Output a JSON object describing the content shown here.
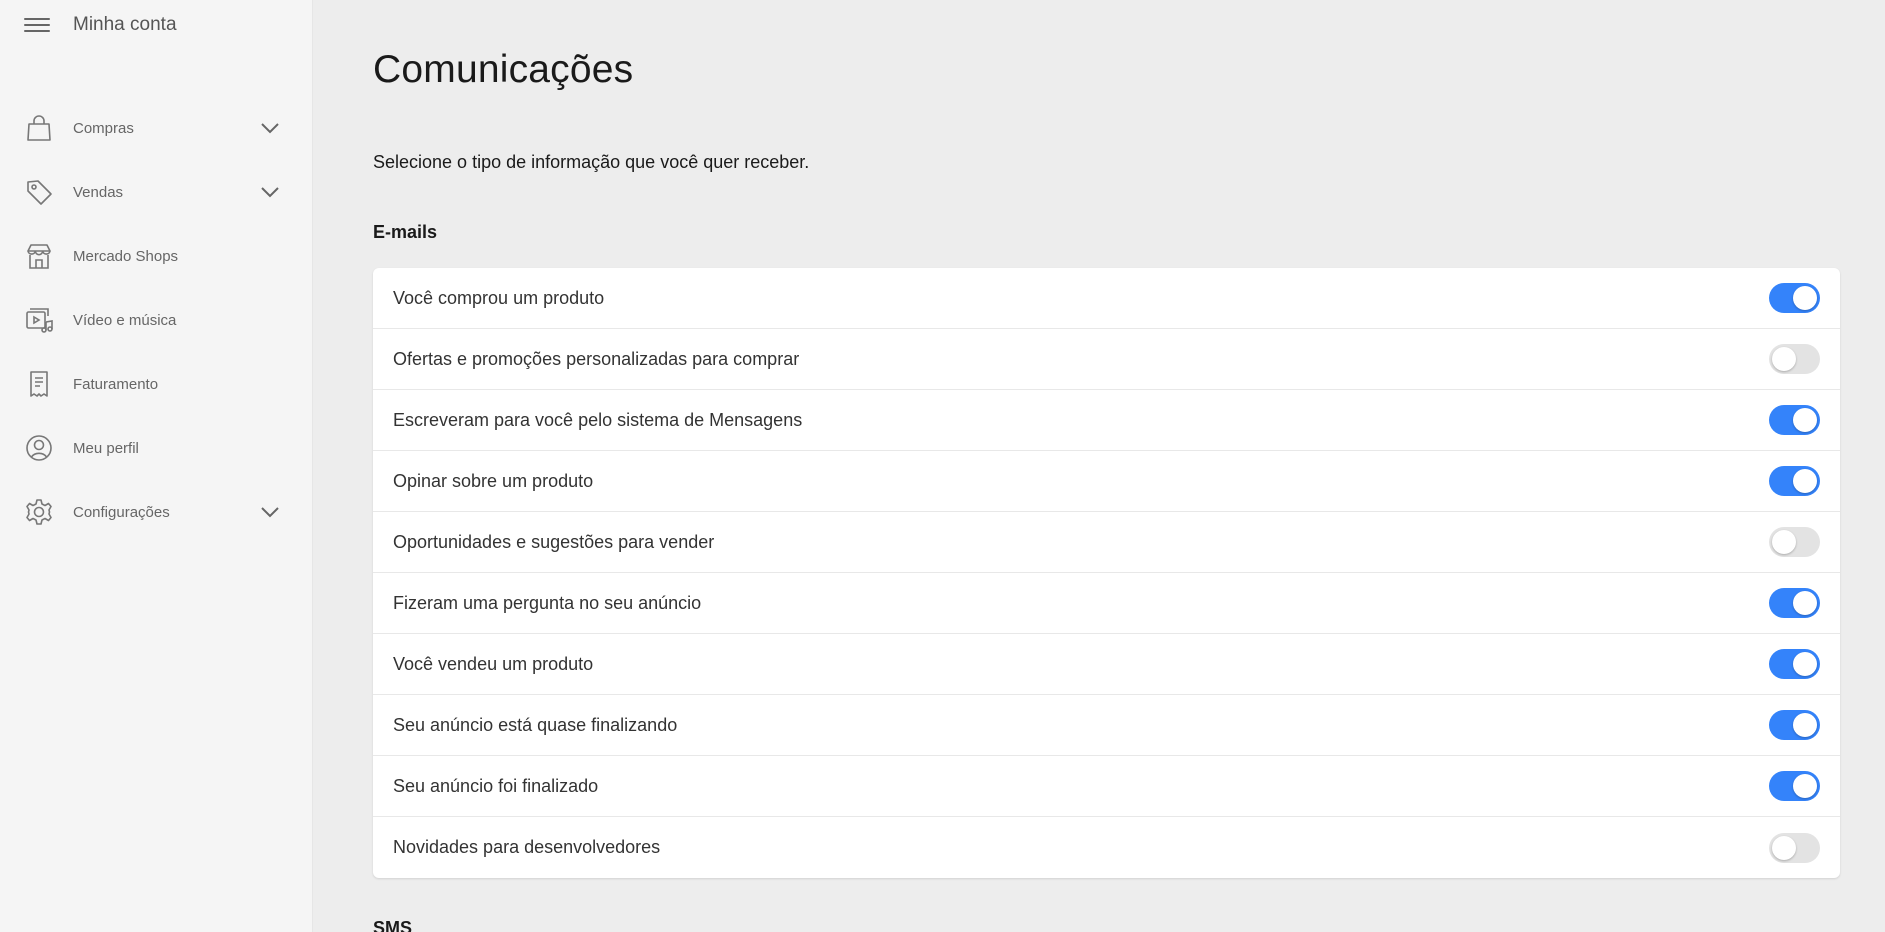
{
  "sidebar": {
    "title": "Minha conta",
    "items": [
      {
        "label": "Compras",
        "icon": "shopping-bag-icon",
        "expandable": true
      },
      {
        "label": "Vendas",
        "icon": "tag-icon",
        "expandable": true
      },
      {
        "label": "Mercado Shops",
        "icon": "store-icon",
        "expandable": false
      },
      {
        "label": "Vídeo e música",
        "icon": "media-icon",
        "expandable": false
      },
      {
        "label": "Faturamento",
        "icon": "receipt-icon",
        "expandable": false
      },
      {
        "label": "Meu perfil",
        "icon": "profile-icon",
        "expandable": false
      },
      {
        "label": "Configurações",
        "icon": "gear-icon",
        "expandable": true
      }
    ]
  },
  "main": {
    "title": "Comunicações",
    "subtitle": "Selecione o tipo de informação que você quer receber.",
    "sections": [
      {
        "title": "E-mails",
        "items": [
          {
            "label": "Você comprou um produto",
            "enabled": true
          },
          {
            "label": "Ofertas e promoções personalizadas para comprar",
            "enabled": false
          },
          {
            "label": "Escreveram para você pelo sistema de Mensagens",
            "enabled": true
          },
          {
            "label": "Opinar sobre um produto",
            "enabled": true
          },
          {
            "label": "Oportunidades e sugestões para vender",
            "enabled": false
          },
          {
            "label": "Fizeram uma pergunta no seu anúncio",
            "enabled": true
          },
          {
            "label": "Você vendeu um produto",
            "enabled": true
          },
          {
            "label": "Seu anúncio está quase finalizando",
            "enabled": true
          },
          {
            "label": "Seu anúncio foi finalizado",
            "enabled": true
          },
          {
            "label": "Novidades para desenvolvedores",
            "enabled": false
          }
        ]
      },
      {
        "title": "SMS",
        "items": []
      }
    ]
  },
  "colors": {
    "accent": "#3483fa",
    "toggle_off": "#e3e3e3",
    "background": "#ededed",
    "sidebar_bg": "#f5f5f5"
  }
}
